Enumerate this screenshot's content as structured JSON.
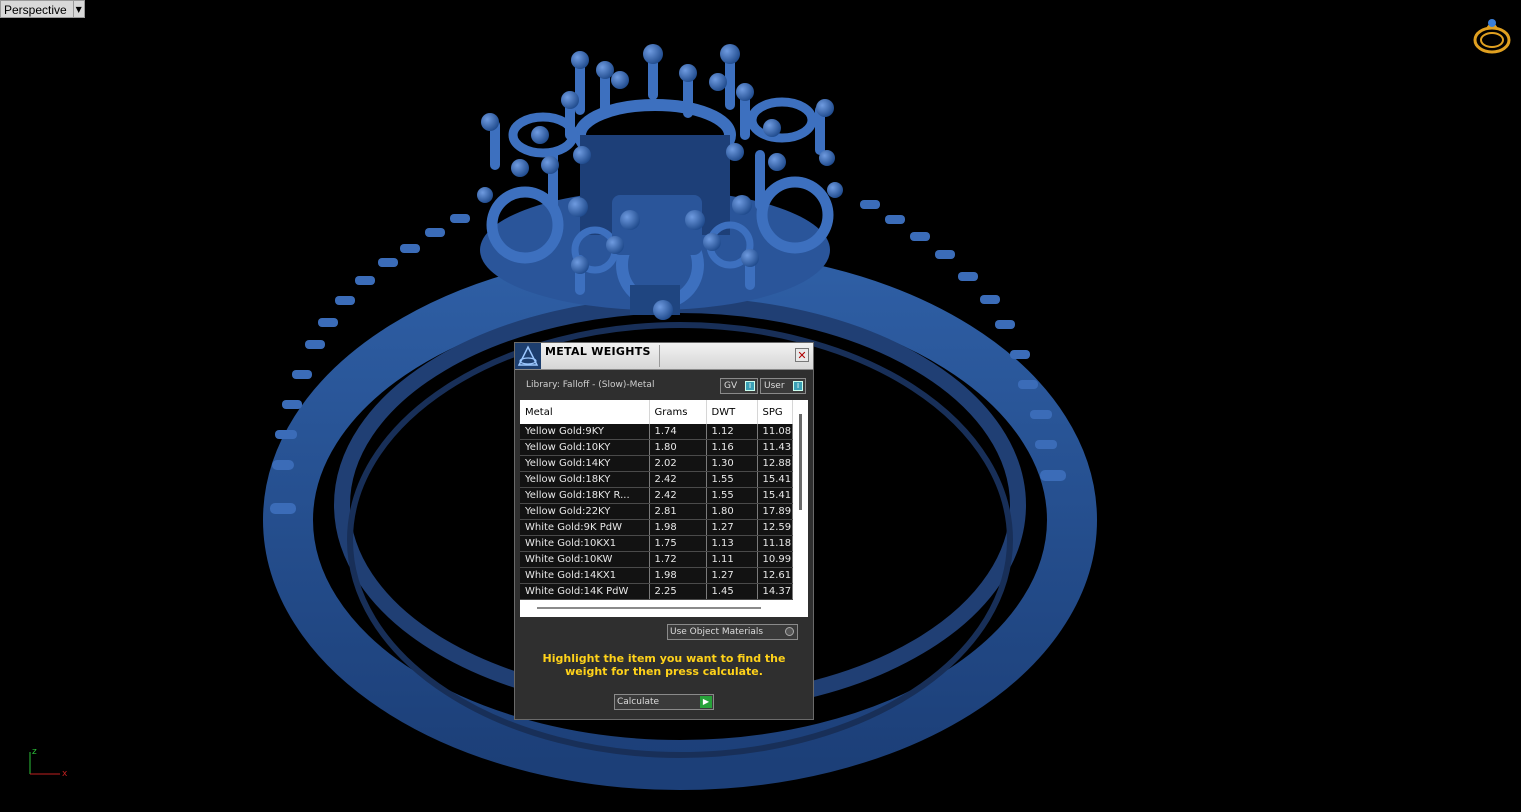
{
  "viewport": {
    "label": "Perspective"
  },
  "dialog": {
    "title": "METAL WEIGHTS",
    "close_glyph": "✕",
    "library_label": "Library: Falloff - (Slow)-Metal",
    "toggle_gv": "GV",
    "toggle_user": "User",
    "columns": [
      "Metal",
      "Grams",
      "DWT",
      "SPG"
    ],
    "rows": [
      [
        "Yellow Gold:9KY",
        "1.74",
        "1.12",
        "11.08"
      ],
      [
        "Yellow Gold:10KY",
        "1.80",
        "1.16",
        "11.43"
      ],
      [
        "Yellow Gold:14KY",
        "2.02",
        "1.30",
        "12.88"
      ],
      [
        "Yellow Gold:18KY",
        "2.42",
        "1.55",
        "15.41"
      ],
      [
        "Yellow Gold:18KY R...",
        "2.42",
        "1.55",
        "15.41"
      ],
      [
        "Yellow Gold:22KY",
        "2.81",
        "1.80",
        "17.89"
      ],
      [
        "White Gold:9K PdW",
        "1.98",
        "1.27",
        "12.59"
      ],
      [
        "White Gold:10KX1",
        "1.75",
        "1.13",
        "11.18"
      ],
      [
        "White Gold:10KW",
        "1.72",
        "1.11",
        "10.99"
      ],
      [
        "White Gold:14KX1",
        "1.98",
        "1.27",
        "12.61"
      ],
      [
        "White Gold:14K PdW",
        "2.25",
        "1.45",
        "14.37"
      ]
    ],
    "use_object_materials": "Use Object Materials",
    "instruction": "Highlight the item you want to find the weight for then press calculate.",
    "calculate_label": "Calculate"
  },
  "axis": {
    "z": "z",
    "x": "x"
  },
  "colors": {
    "model_blue": "#2d5a9e",
    "instruction_yellow": "#ffd21a",
    "go_green": "#27a23a"
  }
}
